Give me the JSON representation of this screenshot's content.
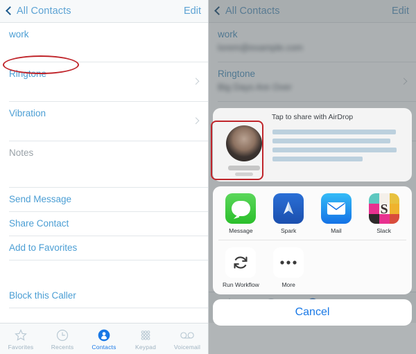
{
  "left_screen": {
    "navbar": {
      "back_label": "All Contacts",
      "back_icon": "chevron-left-icon",
      "edit_label": "Edit"
    },
    "rows": [
      {
        "label": "work",
        "value": "",
        "chevron": false
      },
      {
        "label": "Ringtone",
        "value": "",
        "chevron": true
      },
      {
        "label": "Vibration",
        "value": "",
        "chevron": true
      },
      {
        "label": "Notes",
        "value": "",
        "chevron": false
      },
      {
        "label": "Send Message",
        "value": "",
        "chevron": false
      },
      {
        "label": "Share Contact",
        "value": "",
        "chevron": false
      },
      {
        "label": "Add to Favorites",
        "value": "",
        "chevron": false
      },
      {
        "label": "Block this Caller",
        "value": "",
        "chevron": false
      }
    ],
    "annotation": {
      "shape": "ellipse",
      "target": "Share Contact",
      "color": "#c0252b"
    }
  },
  "right_screen": {
    "navbar": {
      "back_label": "All Contacts",
      "back_icon": "chevron-left-icon",
      "edit_label": "Edit"
    },
    "rows": [
      {
        "label": "work",
        "value_redacted": true,
        "chevron": false
      },
      {
        "label": "Ringtone",
        "value_redacted": true,
        "chevron": true
      },
      {
        "label": "Vibration",
        "value_redacted": true,
        "chevron": true
      }
    ],
    "share_sheet": {
      "airdrop": {
        "title": "Tap to share with AirDrop",
        "description_redacted": true,
        "target_name_redacted": true,
        "target_sub_redacted": true
      },
      "apps": [
        {
          "label": "Message",
          "icon": "messages-icon"
        },
        {
          "label": "Spark",
          "icon": "spark-icon"
        },
        {
          "label": "Mail",
          "icon": "mail-icon"
        },
        {
          "label": "Slack",
          "icon": "slack-icon"
        }
      ],
      "actions": [
        {
          "label": "Run Workflow",
          "icon": "workflow-refresh-icon"
        },
        {
          "label": "More",
          "icon": "more-dots-icon"
        }
      ],
      "cancel_label": "Cancel"
    },
    "annotation": {
      "shape": "rectangle",
      "target": "airdrop-target",
      "color": "#c0252b"
    }
  },
  "tabbar": {
    "items": [
      {
        "label": "Favorites",
        "icon": "star-icon",
        "active": false
      },
      {
        "label": "Recents",
        "icon": "clock-icon",
        "active": false
      },
      {
        "label": "Contacts",
        "icon": "contacts-person-icon",
        "active": true
      },
      {
        "label": "Keypad",
        "icon": "keypad-dots-icon",
        "active": false
      },
      {
        "label": "Voicemail",
        "icon": "voicemail-icon",
        "active": false
      }
    ],
    "active_color": "#1878e6",
    "inactive_color": "#9fb3c1"
  }
}
